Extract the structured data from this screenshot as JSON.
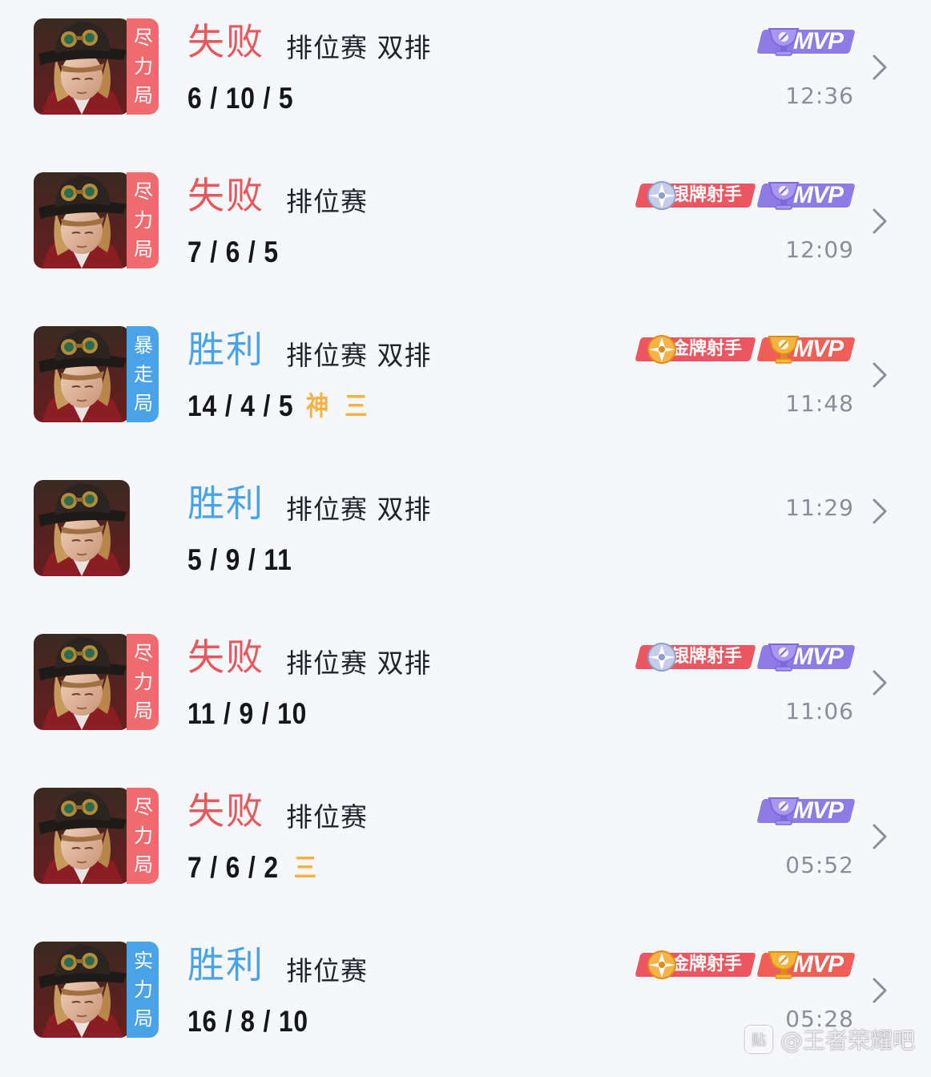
{
  "matches": [
    {
      "result": "失败",
      "outcome": "loss",
      "tag": [
        "尽",
        "力",
        "局"
      ],
      "mode": "排位赛 双排",
      "kda": "6 / 10 / 5",
      "extra": [],
      "badges": [
        {
          "kind": "mvp",
          "tier": "purple",
          "label": "MVP"
        }
      ],
      "time": "12:36"
    },
    {
      "result": "失败",
      "outcome": "loss",
      "tag": [
        "尽",
        "力",
        "局"
      ],
      "mode": "排位赛",
      "kda": "7 / 6 / 5",
      "extra": [],
      "badges": [
        {
          "kind": "ace",
          "tier": "silver",
          "label": "银牌射手"
        },
        {
          "kind": "mvp",
          "tier": "purple",
          "label": "MVP"
        }
      ],
      "time": "12:09"
    },
    {
      "result": "胜利",
      "outcome": "win",
      "tag": [
        "暴",
        "走",
        "局"
      ],
      "mode": "排位赛 双排",
      "kda": "14 / 4 / 5",
      "extra": [
        "神",
        "三"
      ],
      "badges": [
        {
          "kind": "ace",
          "tier": "gold",
          "label": "金牌射手"
        },
        {
          "kind": "mvp",
          "tier": "gold",
          "label": "MVP"
        }
      ],
      "time": "11:48"
    },
    {
      "result": "胜利",
      "outcome": "win",
      "tag": [],
      "mode": "排位赛 双排",
      "kda": "5 / 9 / 11",
      "extra": [],
      "badges": [],
      "time": "11:29"
    },
    {
      "result": "失败",
      "outcome": "loss",
      "tag": [
        "尽",
        "力",
        "局"
      ],
      "mode": "排位赛 双排",
      "kda": "11 / 9 / 10",
      "extra": [],
      "badges": [
        {
          "kind": "ace",
          "tier": "silver",
          "label": "银牌射手"
        },
        {
          "kind": "mvp",
          "tier": "purple",
          "label": "MVP"
        }
      ],
      "time": "11:06"
    },
    {
      "result": "失败",
      "outcome": "loss",
      "tag": [
        "尽",
        "力",
        "局"
      ],
      "mode": "排位赛",
      "kda": "7 / 6 / 2",
      "extra": [
        "三"
      ],
      "badges": [
        {
          "kind": "mvp",
          "tier": "purple",
          "label": "MVP"
        }
      ],
      "time": "05:52"
    },
    {
      "result": "胜利",
      "outcome": "win",
      "tag": [
        "实",
        "力",
        "局"
      ],
      "mode": "排位赛",
      "kda": "16 / 8 / 10",
      "extra": [],
      "badges": [
        {
          "kind": "ace",
          "tier": "gold",
          "label": "金牌射手"
        },
        {
          "kind": "mvp",
          "tier": "gold",
          "label": "MVP"
        }
      ],
      "time": "05:28"
    }
  ],
  "watermark": {
    "icon": "贴",
    "text": "@王者荣耀吧"
  },
  "colors": {
    "loss": "#e6585c",
    "win": "#4aa3e6",
    "accent_orange": "#f5b244",
    "mvp_purple": "#8f7be6",
    "badge_red": "#ec5660"
  },
  "icons": {
    "avatar": "hero-portrait-icon",
    "chevron": "chevron-right-icon",
    "ace_emblem": "ace-emblem-icon",
    "mvp_trophy": "mvp-trophy-icon"
  }
}
